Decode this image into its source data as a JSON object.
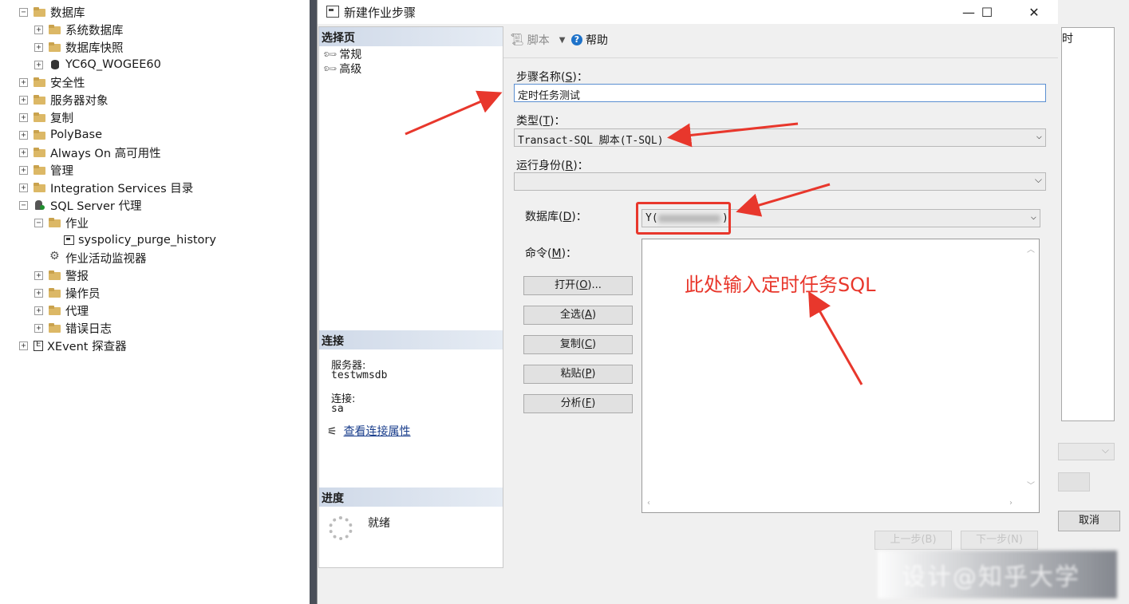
{
  "tree": {
    "items": [
      {
        "label": "数据库",
        "expander": "−"
      },
      {
        "label": "系统数据库",
        "expander": "+"
      },
      {
        "label": "数据库快照",
        "expander": "+"
      },
      {
        "label": "YC6Q_WOGEE60",
        "expander": "+"
      },
      {
        "label": "安全性",
        "expander": "+"
      },
      {
        "label": "服务器对象",
        "expander": "+"
      },
      {
        "label": "复制",
        "expander": "+"
      },
      {
        "label": "PolyBase",
        "expander": "+"
      },
      {
        "label": "Always On 高可用性",
        "expander": "+"
      },
      {
        "label": "管理",
        "expander": "+"
      },
      {
        "label": "Integration Services 目录",
        "expander": "+"
      },
      {
        "label": "SQL Server 代理",
        "expander": "−"
      },
      {
        "label": "作业",
        "expander": "−"
      },
      {
        "label": "syspolicy_purge_history",
        "expander": ""
      },
      {
        "label": "作业活动监视器",
        "expander": ""
      },
      {
        "label": "警报",
        "expander": "+"
      },
      {
        "label": "操作员",
        "expander": "+"
      },
      {
        "label": "代理",
        "expander": "+"
      },
      {
        "label": "错误日志",
        "expander": "+"
      },
      {
        "label": "XEvent 探查器",
        "expander": "+"
      }
    ]
  },
  "dialog": {
    "title": "新建作业步骤",
    "window_buttons": {
      "minimize": "—",
      "maximize": "☐",
      "close": "✕"
    },
    "select_page": {
      "header": "选择页",
      "pages": [
        "常规",
        "高级"
      ]
    },
    "connection": {
      "header": "连接",
      "server_label": "服务器:",
      "server_value": "testwmsdb",
      "connection_label": "连接:",
      "connection_value": "sa",
      "view_link": "查看连接属性"
    },
    "progress": {
      "header": "进度",
      "status": "就绪"
    },
    "toolbar": {
      "script_label": "脚本",
      "help_label": "帮助"
    },
    "form": {
      "step_name_label": "步骤名称",
      "step_name_key": "S",
      "step_name_value": "定时任务测试",
      "type_label": "类型",
      "type_key": "T",
      "type_value": "Transact-SQL 脚本(T-SQL)",
      "run_as_label": "运行身份",
      "run_as_key": "R",
      "run_as_value": "",
      "database_label": "数据库",
      "database_key": "D",
      "database_value": "Y(",
      "database_value_tail": ")",
      "command_label": "命令",
      "command_key": "M"
    },
    "buttons": [
      {
        "label": "打开",
        "key": "O",
        "suffix": "..."
      },
      {
        "label": "全选",
        "key": "A",
        "suffix": ""
      },
      {
        "label": "复制",
        "key": "C",
        "suffix": ""
      },
      {
        "label": "粘贴",
        "key": "P",
        "suffix": ""
      },
      {
        "label": "分析",
        "key": "F",
        "suffix": ""
      }
    ],
    "nav": {
      "prev": "上一步(B)",
      "next": "下一步(N)"
    },
    "annotation": "此处输入定时任务SQL"
  },
  "parent_dialog": {
    "text_fragment": "时",
    "cancel_label": "取消"
  },
  "watermark": "设计@知乎大学",
  "colors": {
    "annotation_red": "#e8372c",
    "folder": "#dcb866",
    "link_blue": "#1a3e8c",
    "section_header": "#cfd9e8",
    "divider": "#4a4f59"
  }
}
